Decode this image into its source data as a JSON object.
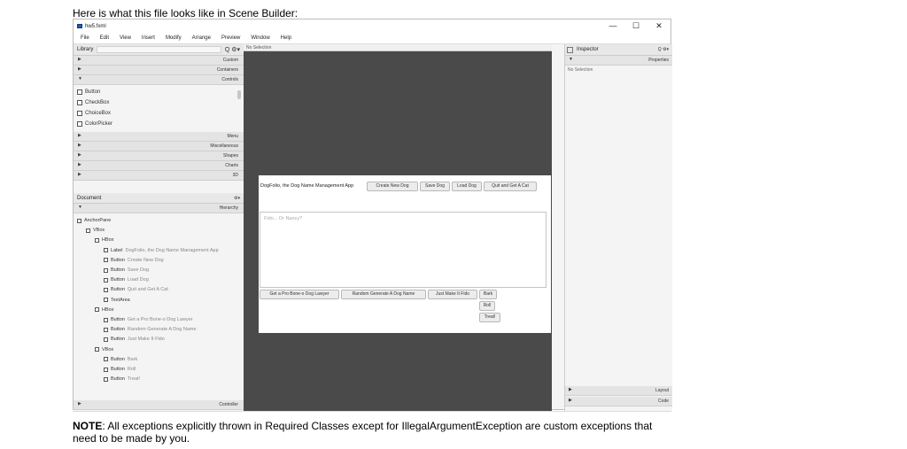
{
  "caption_top": "Here is what this file looks like in Scene Builder:",
  "window": {
    "title": "hw5.fxml",
    "min": "—",
    "max": "☐",
    "close": "✕"
  },
  "menu": [
    "File",
    "Edit",
    "View",
    "Insert",
    "Modify",
    "Arrange",
    "Preview",
    "Window",
    "Help"
  ],
  "library": {
    "title": "Library",
    "search_icon": "Q ⚙▾",
    "sections": [
      "Custom",
      "Containers",
      "Controls"
    ],
    "controls": [
      "Button",
      "CheckBox",
      "ChoiceBox",
      "ColorPicker"
    ],
    "sections2": [
      "Menu",
      "Miscellaneous",
      "Shapes",
      "Charts",
      "3D"
    ]
  },
  "document": {
    "title": "Document",
    "gear": "⚙▾",
    "hierarchy": "Hierarchy",
    "controller": "Controller",
    "tree": [
      {
        "type": "AnchorPane",
        "caption": ""
      },
      {
        "type": "VBox",
        "caption": ""
      },
      {
        "type": "HBox",
        "caption": ""
      },
      {
        "type": "Label",
        "caption": "DogFolio, the Dog Name Management App"
      },
      {
        "type": "Button",
        "caption": "Create New Dog"
      },
      {
        "type": "Button",
        "caption": "Save Dog"
      },
      {
        "type": "Button",
        "caption": "Load Dog"
      },
      {
        "type": "Button",
        "caption": "Quit and Get A Cat"
      },
      {
        "type": "TextArea",
        "caption": ""
      },
      {
        "type": "HBox",
        "caption": ""
      },
      {
        "type": "Button",
        "caption": "Get a Pro Bone-o Dog Lawyer"
      },
      {
        "type": "Button",
        "caption": "Random Generate A Dog Name"
      },
      {
        "type": "Button",
        "caption": "Just Make It Fido"
      },
      {
        "type": "VBox",
        "caption": ""
      },
      {
        "type": "Button",
        "caption": "Bark"
      },
      {
        "type": "Button",
        "caption": "Roll"
      },
      {
        "type": "Button",
        "caption": "Treat!"
      }
    ]
  },
  "center": {
    "no_selection": "No Selection",
    "label": "DogFolio, the Dog Name Management App",
    "top_buttons": [
      "Create New Dog",
      "Save Dog",
      "Load Dog",
      "Quit and Get A Cat"
    ],
    "placeholder": "Fido... Or Nancy?",
    "bottom_buttons": [
      "Get a Pro Bone-o Dog Lawyer",
      "Random Generate A Dog Name",
      "Just Make It Fido"
    ],
    "stack_buttons": [
      "Bark",
      "Roll",
      "Treat!"
    ]
  },
  "inspector": {
    "title": "Inspector",
    "search_icon": "Q ⚙▾",
    "properties": "Properties",
    "no_selection": "No Selection",
    "layout": "Layout",
    "code": "Code"
  },
  "caption_note": {
    "bold": "NOTE",
    "text": ": All exceptions explicitly thrown in Required Classes except for IllegalArgumentException are custom exceptions that need to be made by you."
  }
}
